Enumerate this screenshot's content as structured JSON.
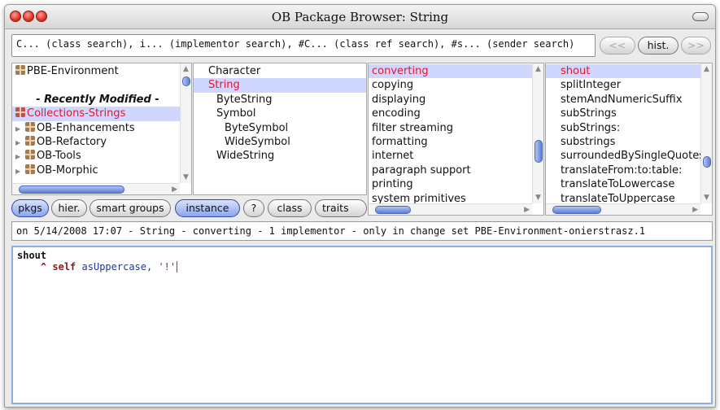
{
  "window": {
    "title": "OB Package Browser: String"
  },
  "search": {
    "value": "C... (class search), i... (implementor search), #C... (class ref search), #s... (sender search)",
    "back_label": "<<",
    "history_label": "hist.",
    "forward_label": ">>"
  },
  "packages": {
    "items": [
      {
        "label": "PBE-Environment",
        "style": "package"
      },
      {
        "label": "",
        "style": "blank"
      },
      {
        "label": "- Recently Modified -",
        "style": "header"
      },
      {
        "label": "Collections-Strings",
        "style": "selected-package"
      },
      {
        "label": "OB-Enhancements",
        "style": "package-expandable"
      },
      {
        "label": "OB-Refactory",
        "style": "package-expandable"
      },
      {
        "label": "OB-Tools",
        "style": "package-expandable"
      },
      {
        "label": "OB-Morphic",
        "style": "package-expandable"
      }
    ]
  },
  "classes": {
    "items": [
      {
        "label": "Character",
        "indent": 0
      },
      {
        "label": "String",
        "indent": 0,
        "selected": true
      },
      {
        "label": "ByteString",
        "indent": 1
      },
      {
        "label": "Symbol",
        "indent": 1
      },
      {
        "label": "ByteSymbol",
        "indent": 2
      },
      {
        "label": "WideSymbol",
        "indent": 2
      },
      {
        "label": "WideString",
        "indent": 1
      }
    ]
  },
  "protocols": {
    "items": [
      "converting",
      "copying",
      "displaying",
      "encoding",
      "filter streaming",
      "formatting",
      "internet",
      "paragraph support",
      "printing",
      "system primitives"
    ],
    "selected_index": 0
  },
  "methods": {
    "items": [
      "shout",
      "splitInteger",
      "stemAndNumericSuffix",
      "subStrings",
      "subStrings:",
      "substrings",
      "surroundedBySingleQuotes",
      "translateFrom:to:table:",
      "translateToLowercase",
      "translateToUppercase"
    ],
    "selected_index": 0
  },
  "buttons": {
    "pkgs": "pkgs",
    "hier": "hier.",
    "smart_groups": "smart groups",
    "instance": "instance",
    "help": "?",
    "class": "class",
    "traits": "traits"
  },
  "status": {
    "text": "on 5/14/2008 17:07 - String - converting - 1 implementor - only in change set PBE-Environment-onierstrasz.1"
  },
  "editor": {
    "selector": "shout",
    "caret": "^",
    "receiver": "self",
    "message": "asUppercase,",
    "argument": "'!'"
  },
  "colors": {
    "selection_bg": "#cfd7ff",
    "selection_text": "#e8142a",
    "scroll_thumb": "#5a7ed6",
    "editor_border": "#8faedc"
  }
}
